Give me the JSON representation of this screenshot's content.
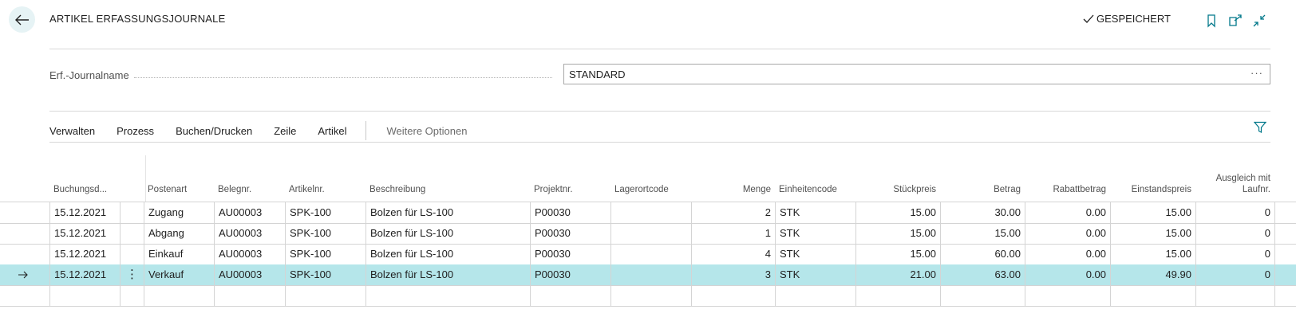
{
  "header": {
    "title": "ARTIKEL ERFASSUNGSJOURNALE",
    "saved_label": "GESPEICHERT"
  },
  "journal_field": {
    "label": "Erf.-Journalname",
    "value": "STANDARD",
    "more": "···"
  },
  "actions": [
    "Verwalten",
    "Prozess",
    "Buchen/Drucken",
    "Zeile",
    "Artikel"
  ],
  "more_options": "Weitere Optionen",
  "table": {
    "columns": [
      {
        "label": "Buchungsd...",
        "align": "left"
      },
      {
        "label": "",
        "align": "left"
      },
      {
        "label": "Postenart",
        "align": "left"
      },
      {
        "label": "Belegnr.",
        "align": "left"
      },
      {
        "label": "Artikelnr.",
        "align": "left"
      },
      {
        "label": "Beschreibung",
        "align": "left"
      },
      {
        "label": "Projektnr.",
        "align": "left"
      },
      {
        "label": "Lagerortcode",
        "align": "left"
      },
      {
        "label": "Menge",
        "align": "right"
      },
      {
        "label": "Einheitencode",
        "align": "left"
      },
      {
        "label": "Stückpreis",
        "align": "right"
      },
      {
        "label": "Betrag",
        "align": "right"
      },
      {
        "label": "Rabattbetrag",
        "align": "right"
      },
      {
        "label": "Einstandspreis",
        "align": "right"
      },
      {
        "label": "Ausgleich mit Laufnr.",
        "align": "right"
      }
    ],
    "rows": [
      {
        "selected": false,
        "cells": [
          "15.12.2021",
          "",
          "Zugang",
          "AU00003",
          "SPK-100",
          "Bolzen für LS-100",
          "P00030",
          "",
          "2",
          "STK",
          "15.00",
          "30.00",
          "0.00",
          "15.00",
          "0"
        ]
      },
      {
        "selected": false,
        "cells": [
          "15.12.2021",
          "",
          "Abgang",
          "AU00003",
          "SPK-100",
          "Bolzen für LS-100",
          "P00030",
          "",
          "1",
          "STK",
          "15.00",
          "15.00",
          "0.00",
          "15.00",
          "0"
        ]
      },
      {
        "selected": false,
        "cells": [
          "15.12.2021",
          "",
          "Einkauf",
          "AU00003",
          "SPK-100",
          "Bolzen für LS-100",
          "P00030",
          "",
          "4",
          "STK",
          "15.00",
          "60.00",
          "0.00",
          "15.00",
          "0"
        ]
      },
      {
        "selected": true,
        "cells": [
          "15.12.2021",
          "⋮",
          "Verkauf",
          "AU00003",
          "SPK-100",
          "Bolzen für LS-100",
          "P00030",
          "",
          "3",
          "STK",
          "21.00",
          "63.00",
          "0.00",
          "49.90",
          "0"
        ]
      },
      {
        "selected": false,
        "cells": [
          "",
          "",
          "",
          "",
          "",
          "",
          "",
          "",
          "",
          "",
          "",
          "",
          "",
          "",
          ""
        ]
      }
    ]
  },
  "icons": {
    "back": "back-arrow-icon",
    "check": "check-icon",
    "bookmark": "bookmark-icon",
    "open_new_window": "open-in-new-window-icon",
    "collapse": "collapse-icon",
    "filter": "filter-icon",
    "row_marker": "row-arrow-icon"
  },
  "colors": {
    "accent": "#00788a",
    "selected_row": "#b5e6ea",
    "back_button_bg": "#e6f3f5"
  }
}
